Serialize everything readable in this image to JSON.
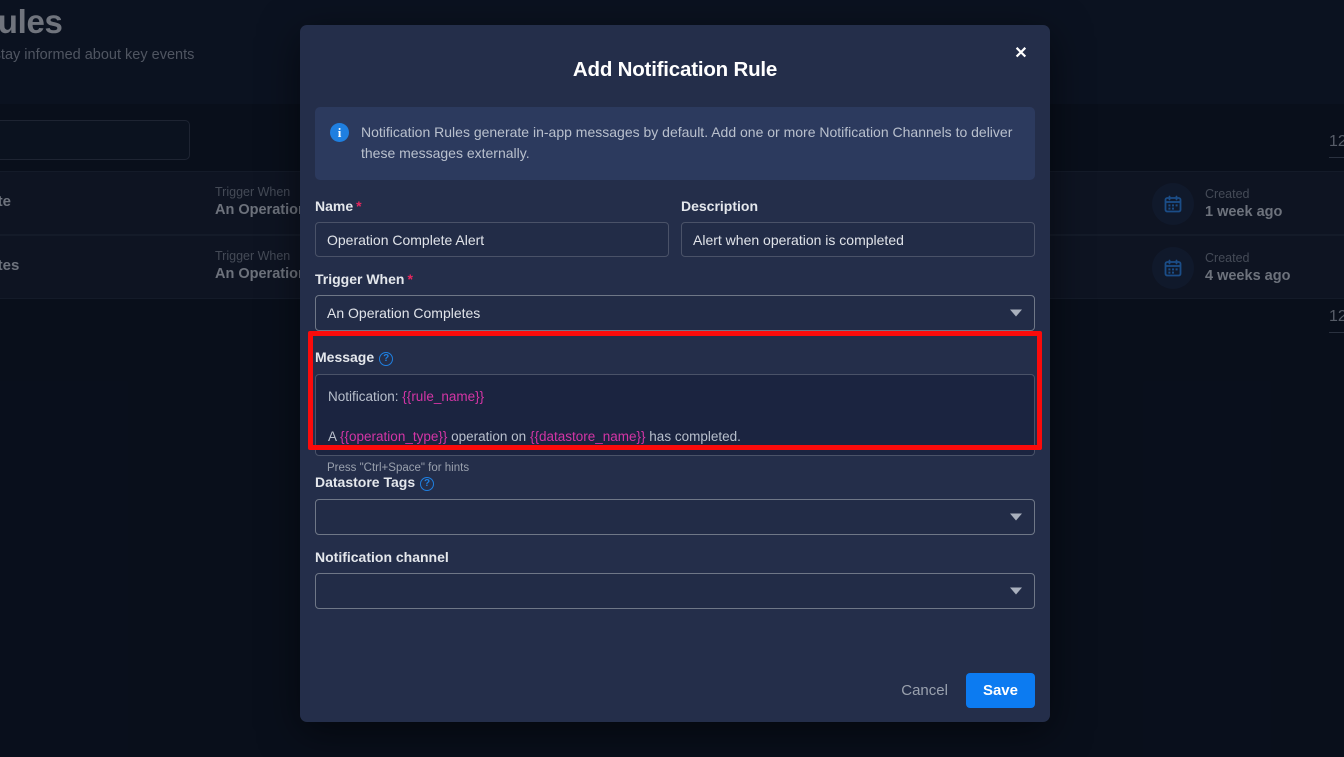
{
  "background": {
    "page_title": "ation Rules",
    "page_subtitle": "n rules to stay informed about key events",
    "rows": [
      {
        "name": "ion Complete",
        "trigger_label": "Trigger When",
        "trigger_value": "An Operation (",
        "created_label": "Created",
        "created_value": "1 week ago",
        "calendar_icon": "calendar-icon"
      },
      {
        "name": "ion Completes",
        "trigger_label": "Trigger When",
        "trigger_value": "An Operation (",
        "created_label": "Created",
        "created_value": "4 weeks ago",
        "calendar_icon": "calendar-icon"
      }
    ],
    "page_numbers": [
      "12",
      "12"
    ]
  },
  "modal": {
    "title": "Add Notification Rule",
    "close_label": "✕",
    "close_icon": "close-icon",
    "info": {
      "icon": "info-icon",
      "icon_glyph": "i",
      "text": "Notification Rules generate in-app messages by default. Add one or more Notification Channels to deliver these messages externally."
    },
    "fields": {
      "name": {
        "label": "Name",
        "required_marker": "*",
        "value": "Operation Complete Alert",
        "placeholder": ""
      },
      "description": {
        "label": "Description",
        "value": "Alert when operation is completed",
        "placeholder": ""
      },
      "trigger_when": {
        "label": "Trigger When",
        "required_marker": "*",
        "value": "An Operation Completes",
        "caret_icon": "chevron-down-icon"
      },
      "message": {
        "label": "Message",
        "help_icon": "help-icon",
        "help_glyph": "?",
        "line1_prefix": "Notification: ",
        "line1_var": "{{rule_name}}",
        "line2_a": "A ",
        "line2_var1": "{{operation_type}}",
        "line2_b": " operation on ",
        "line2_var2": "{{datastore_name}}",
        "line2_c": " has completed.",
        "hint": "Press \"Ctrl+Space\" for hints"
      },
      "datastore_tags": {
        "label": "Datastore Tags",
        "help_icon": "help-icon",
        "help_glyph": "?",
        "value": "",
        "caret_icon": "chevron-down-icon"
      },
      "notification_channel": {
        "label": "Notification channel",
        "value": "",
        "caret_icon": "chevron-down-icon"
      }
    },
    "footer": {
      "cancel_label": "Cancel",
      "save_label": "Save"
    }
  },
  "colors": {
    "accent_blue": "#0c7bf1",
    "modal_bg": "#242e4a",
    "page_bg": "#0d1424",
    "required_red": "#e8275f",
    "highlight_red": "#fb0b0b",
    "template_var": "#d335a5"
  }
}
